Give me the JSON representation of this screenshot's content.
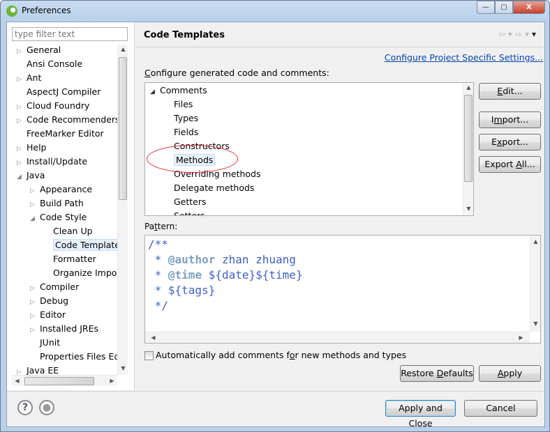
{
  "window": {
    "title": "Preferences",
    "minimize": "—",
    "maximize": "▢",
    "close": "X"
  },
  "filter": {
    "placeholder": "type filter text"
  },
  "tree": [
    {
      "label": "General",
      "level": 0,
      "state": "collapsed"
    },
    {
      "label": "Ansi Console",
      "level": 0,
      "state": "none"
    },
    {
      "label": "Ant",
      "level": 0,
      "state": "collapsed"
    },
    {
      "label": "AspectJ Compiler",
      "level": 0,
      "state": "none"
    },
    {
      "label": "Cloud Foundry",
      "level": 0,
      "state": "collapsed"
    },
    {
      "label": "Code Recommenders",
      "level": 0,
      "state": "collapsed"
    },
    {
      "label": "FreeMarker Editor",
      "level": 0,
      "state": "none"
    },
    {
      "label": "Help",
      "level": 0,
      "state": "collapsed"
    },
    {
      "label": "Install/Update",
      "level": 0,
      "state": "collapsed"
    },
    {
      "label": "Java",
      "level": 0,
      "state": "expanded"
    },
    {
      "label": "Appearance",
      "level": 1,
      "state": "collapsed"
    },
    {
      "label": "Build Path",
      "level": 1,
      "state": "collapsed"
    },
    {
      "label": "Code Style",
      "level": 1,
      "state": "expanded"
    },
    {
      "label": "Clean Up",
      "level": 2,
      "state": "none"
    },
    {
      "label": "Code Template",
      "level": 2,
      "state": "none",
      "selected": true
    },
    {
      "label": "Formatter",
      "level": 2,
      "state": "none"
    },
    {
      "label": "Organize Impo",
      "level": 2,
      "state": "none"
    },
    {
      "label": "Compiler",
      "level": 1,
      "state": "collapsed"
    },
    {
      "label": "Debug",
      "level": 1,
      "state": "collapsed"
    },
    {
      "label": "Editor",
      "level": 1,
      "state": "collapsed"
    },
    {
      "label": "Installed JREs",
      "level": 1,
      "state": "collapsed"
    },
    {
      "label": "JUnit",
      "level": 1,
      "state": "none"
    },
    {
      "label": "Properties Files Ed",
      "level": 1,
      "state": "none"
    },
    {
      "label": "Java EE",
      "level": 0,
      "state": "collapsed"
    }
  ],
  "page": {
    "title": "Code Templates",
    "project_link": "Configure Project Specific Settings...",
    "configure_label": "Configure generated code and comments:",
    "templates": [
      {
        "label": "Comments",
        "level": 0,
        "state": "expanded"
      },
      {
        "label": "Files",
        "level": 1
      },
      {
        "label": "Types",
        "level": 1
      },
      {
        "label": "Fields",
        "level": 1
      },
      {
        "label": "Constructors",
        "level": 1
      },
      {
        "label": "Methods",
        "level": 1,
        "selected": true
      },
      {
        "label": "Overriding methods",
        "level": 1
      },
      {
        "label": "Delegate methods",
        "level": 1
      },
      {
        "label": "Getters",
        "level": 1
      },
      {
        "label": "Setters",
        "level": 1
      }
    ],
    "buttons": {
      "edit": "Edit...",
      "import": "Import...",
      "export": "Export...",
      "export_all": "Export All..."
    },
    "pattern_label": "Pattern:",
    "pattern": {
      "l1": "/**",
      "l2_prefix": " * ",
      "l2_tag": "@author",
      "l2_text": " zhan zhuang",
      "l3_prefix": " * ",
      "l3_tag": "@time",
      "l3_text": " ${date}${time}",
      "l4": " * ${tags}",
      "l5": " */"
    },
    "auto_comment": {
      "label": "Automatically add comments for new methods and types",
      "checked": false
    },
    "restore_defaults": "Restore Defaults",
    "apply": "Apply"
  },
  "footer": {
    "apply_close": "Apply and Close",
    "cancel": "Cancel"
  }
}
